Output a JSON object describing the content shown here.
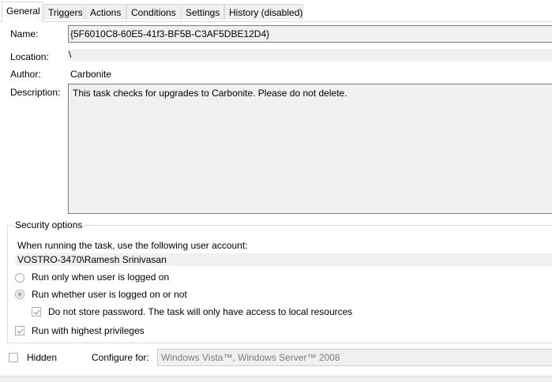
{
  "tabs": [
    {
      "label": "General",
      "active": true
    },
    {
      "label": "Triggers"
    },
    {
      "label": "Actions"
    },
    {
      "label": "Conditions"
    },
    {
      "label": "Settings"
    },
    {
      "label": "History (disabled)"
    }
  ],
  "general": {
    "name_label": "Name:",
    "name_value": "{5F6010C8-60E5-41f3-BF5B-C3AF5DBE12D4}",
    "location_label": "Location:",
    "location_value": "\\",
    "author_label": "Author:",
    "author_value": "Carbonite",
    "description_label": "Description:",
    "description_value": "This task checks for upgrades to Carbonite. Please do not delete."
  },
  "security": {
    "title": "Security options",
    "account_prompt": "When running the task, use the following user account:",
    "account_value": "VOSTRO-3470\\Ramesh Srinivasan",
    "radio_logged_on": "Run only when user is logged on",
    "radio_whether": "Run whether user is logged on or not",
    "radio_selected": "whether",
    "do_not_store": "Do not store password.  The task will only have access to local resources",
    "do_not_store_checked": true,
    "highest_privileges": "Run with highest privileges",
    "highest_privileges_checked": true
  },
  "footer": {
    "hidden_label": "Hidden",
    "hidden_checked": false,
    "configure_label": "Configure for:",
    "configure_value": "Windows Vista™, Windows Server™ 2008"
  },
  "colors": {
    "disabled_text": "#7a7a7a",
    "field_bg": "#f0f0f0",
    "border": "#d9d9d9"
  }
}
